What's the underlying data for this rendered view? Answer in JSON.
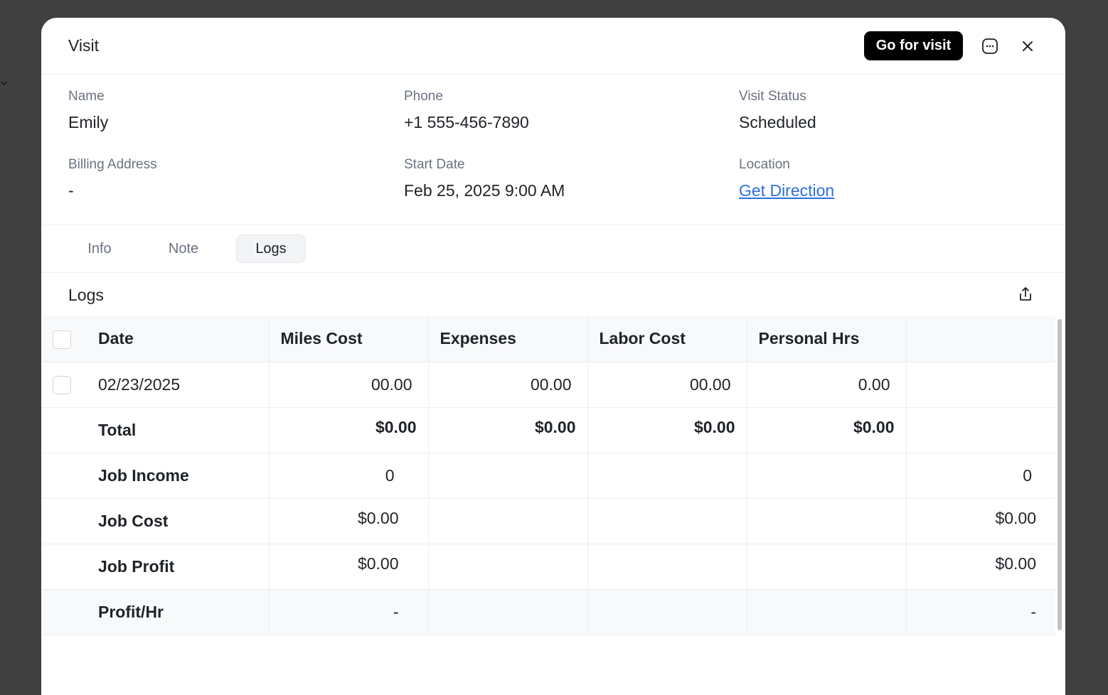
{
  "modal": {
    "title": "Visit",
    "go_button": "Go for visit"
  },
  "info": {
    "name_label": "Name",
    "name_value": "Emily",
    "phone_label": "Phone",
    "phone_value": "+1 555-456-7890",
    "status_label": "Visit Status",
    "status_value": "Scheduled",
    "billing_label": "Billing Address",
    "billing_value": "-",
    "start_label": "Start Date",
    "start_value": "Feb 25, 2025 9:00 AM",
    "location_label": "Location",
    "location_value": "Get Direction"
  },
  "tabs": [
    {
      "label": "Info"
    },
    {
      "label": "Note"
    },
    {
      "label": "Logs",
      "active": true
    }
  ],
  "logs": {
    "title": "Logs",
    "columns": [
      "Date",
      "Miles Cost",
      "Expenses",
      "Labor Cost",
      "Personal Hrs",
      ""
    ],
    "entry": {
      "date": "02/23/2025",
      "miles": "00.00",
      "expenses": "00.00",
      "labor": "00.00",
      "personal": "0.00"
    },
    "total": {
      "label": "Total",
      "miles": "$0.00",
      "expenses": "$0.00",
      "labor": "$0.00",
      "personal": "$0.00"
    },
    "job_income": {
      "label": "Job Income",
      "miles": "0",
      "last": "0"
    },
    "job_cost": {
      "label": "Job Cost",
      "miles": "$0.00",
      "last": "$0.00"
    },
    "job_profit": {
      "label": "Job Profit",
      "miles": "$0.00",
      "last": "$0.00"
    },
    "profit_hr": {
      "label": "Profit/Hr",
      "miles": "-",
      "last": "-"
    }
  },
  "colors": {
    "accent": "#000000",
    "link": "#2f6fde",
    "overlay": "#404040"
  }
}
